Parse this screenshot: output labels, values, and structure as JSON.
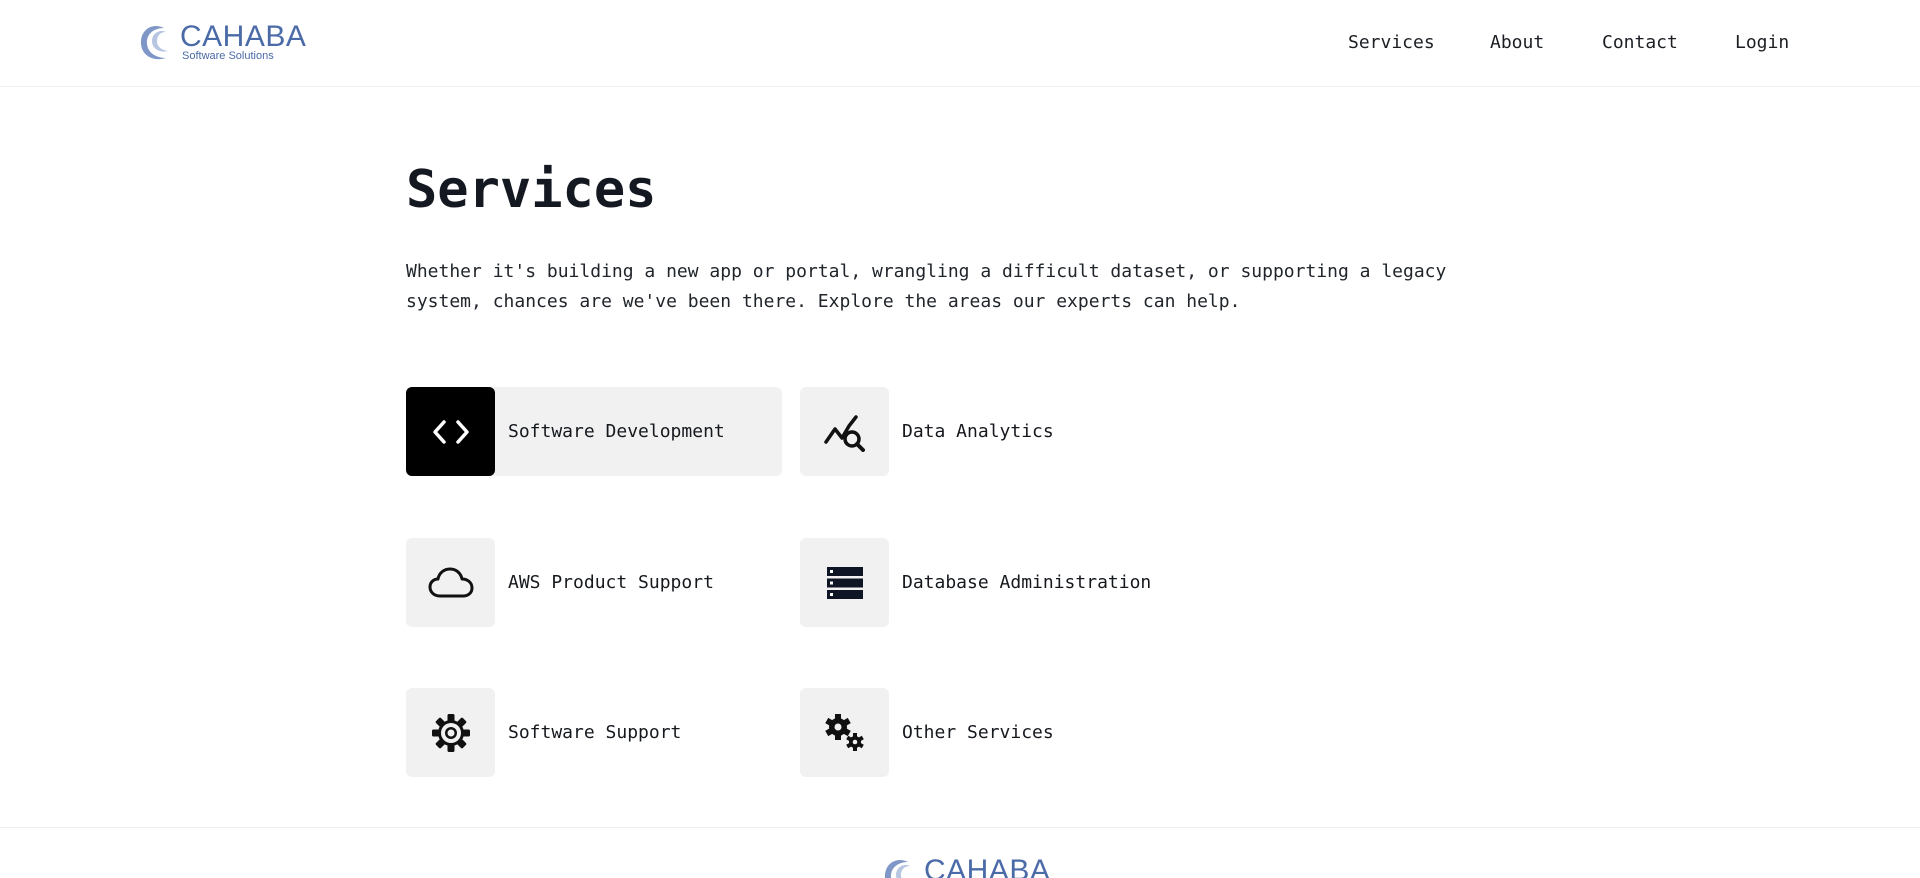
{
  "brand": {
    "name": "CAHABA",
    "tagline": "Software Solutions",
    "color": "#4a6aa8"
  },
  "nav": {
    "items": [
      {
        "label": "Services"
      },
      {
        "label": "About"
      },
      {
        "label": "Contact"
      },
      {
        "label": "Login"
      }
    ]
  },
  "main": {
    "title": "Services",
    "intro": "Whether it's building a new app or portal, wrangling a difficult dataset, or supporting a legacy system, chances are we've been there. Explore the areas our experts can help."
  },
  "services": [
    {
      "label": "Software Development",
      "icon": "code-icon",
      "active": true
    },
    {
      "label": "Data Analytics",
      "icon": "analytics-icon",
      "active": false
    },
    {
      "label": "AWS Product Support",
      "icon": "cloud-icon",
      "active": false
    },
    {
      "label": "Database Administration",
      "icon": "server-icon",
      "active": false
    },
    {
      "label": "Software Support",
      "icon": "gear-icon",
      "active": false
    },
    {
      "label": "Other Services",
      "icon": "gears-icon",
      "active": false
    }
  ],
  "footer": {
    "brand_name": "CAHABA"
  }
}
